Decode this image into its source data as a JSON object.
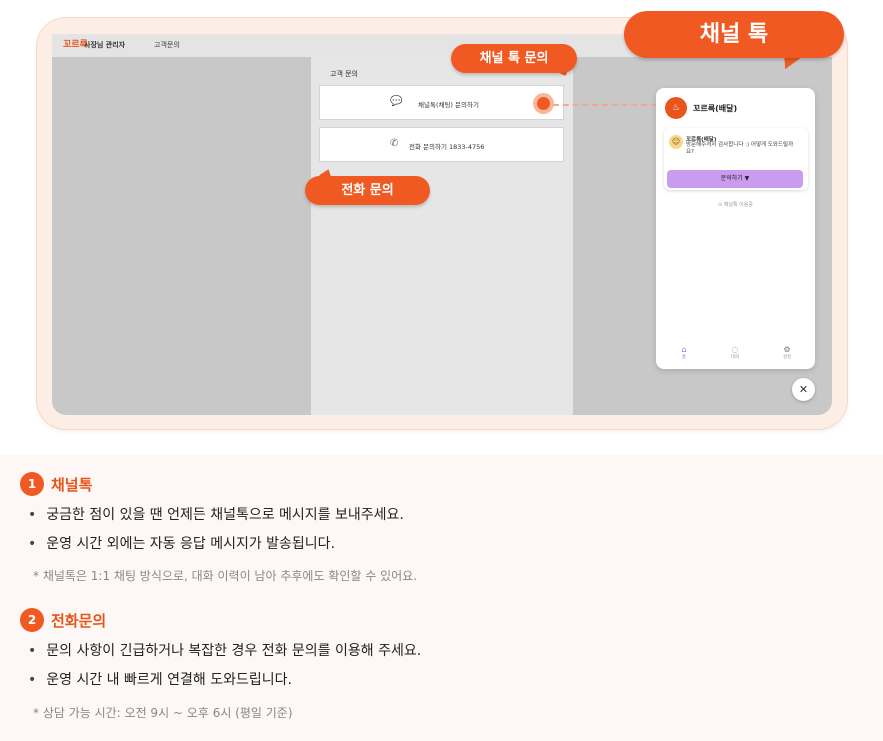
{
  "header": {
    "brand_logo": "꼬르륵",
    "brand_title": "사장님 관리자",
    "nav_link": "고객문의"
  },
  "inquiry": {
    "section_label": "고객 문의",
    "channel_option": "채널톡(채팅) 문의하기",
    "phone_option": "전화 문의하기 1833-4756"
  },
  "callouts": {
    "channel_small": "채널 톡 문의",
    "phone": "전화 문의",
    "channel_big": "채널 톡"
  },
  "widget": {
    "title": "꼬르륵(배달)",
    "sender": "꼬르륵(배달)",
    "message": "방문해주셔서 감사합니다 :) 어떻게 도와드릴까요?",
    "button": "문의하기 ▼",
    "powered": "⊙ 채널톡 이용중",
    "tabs": [
      {
        "icon": "⌂",
        "label": "홈"
      },
      {
        "icon": "◌",
        "label": "대화"
      },
      {
        "icon": "⚙",
        "label": "설정"
      }
    ],
    "close": "✕"
  },
  "info": {
    "sections": [
      {
        "number": "1",
        "title": "채널톡",
        "bullets": [
          "궁금한 점이 있을 땐 언제든 채널톡으로 메시지를 보내주세요.",
          "운영 시간 외에는 자동 응답 메시지가 발송됩니다."
        ],
        "note": "* 채널톡은 1:1 채팅 방식으로, 대화 이력이 남아 추후에도 확인할 수 있어요."
      },
      {
        "number": "2",
        "title": "전화문의",
        "bullets": [
          "문의 사항이 긴급하거나 복잡한 경우 전화 문의를 이용해 주세요.",
          "운영 시간 내 빠르게 연결해 도와드립니다."
        ],
        "note": "* 상담 가능 시간: 오전 9시 ~ 오후 6시 (평일 기준)"
      }
    ]
  },
  "colors": {
    "accent": "#f05a22",
    "widget_button": "#c99cf0",
    "tablet_bg": "#fdeee5"
  }
}
